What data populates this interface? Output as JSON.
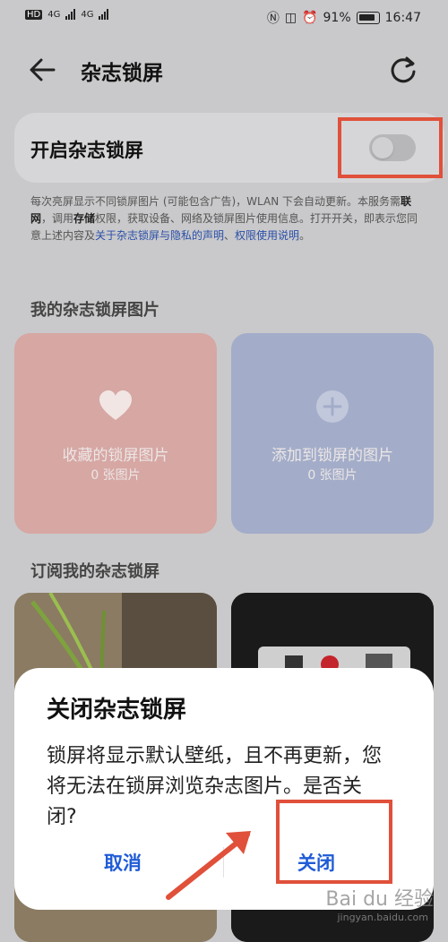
{
  "status_bar": {
    "left_badges": [
      "HD",
      "4G",
      "4G"
    ],
    "battery": "91%",
    "time": "16:47"
  },
  "header": {
    "title": "杂志锁屏"
  },
  "toggle_card": {
    "label": "开启杂志锁屏",
    "enabled": false
  },
  "notice": {
    "part1": "每次亮屏显示不同锁屏图片 (可能包含广告)，WLAN 下会自动更新。本服务需",
    "bold1": "联网",
    "part2": "，调用",
    "bold2": "存储",
    "part3": "权限，获取设备、网络及锁屏图片使用信息。打开开关，即表示您同意上述内容及",
    "link1": "关于杂志锁屏与隐私的声明",
    "sep": "、",
    "link2": "权限使用说明",
    "end": "。"
  },
  "my_pictures": {
    "title": "我的杂志锁屏图片",
    "favorites": {
      "name": "收藏的锁屏图片",
      "count": "0 张图片"
    },
    "added": {
      "name": "添加到锁屏的图片",
      "count": "0 张图片"
    }
  },
  "subscriptions": {
    "title": "订阅我的杂志锁屏"
  },
  "dialog": {
    "title": "关闭杂志锁屏",
    "body": "锁屏将显示默认壁纸，且不再更新，您将无法在锁屏浏览杂志图片。是否关闭?",
    "cancel_label": "取消",
    "close_label": "关闭"
  },
  "watermark": {
    "text": "Bai du 经验",
    "url": "jingyan.baidu.com"
  },
  "colors": {
    "accent": "#1f5bd6",
    "annotation": "#e0503a",
    "scrim": "#c9c9cb"
  }
}
